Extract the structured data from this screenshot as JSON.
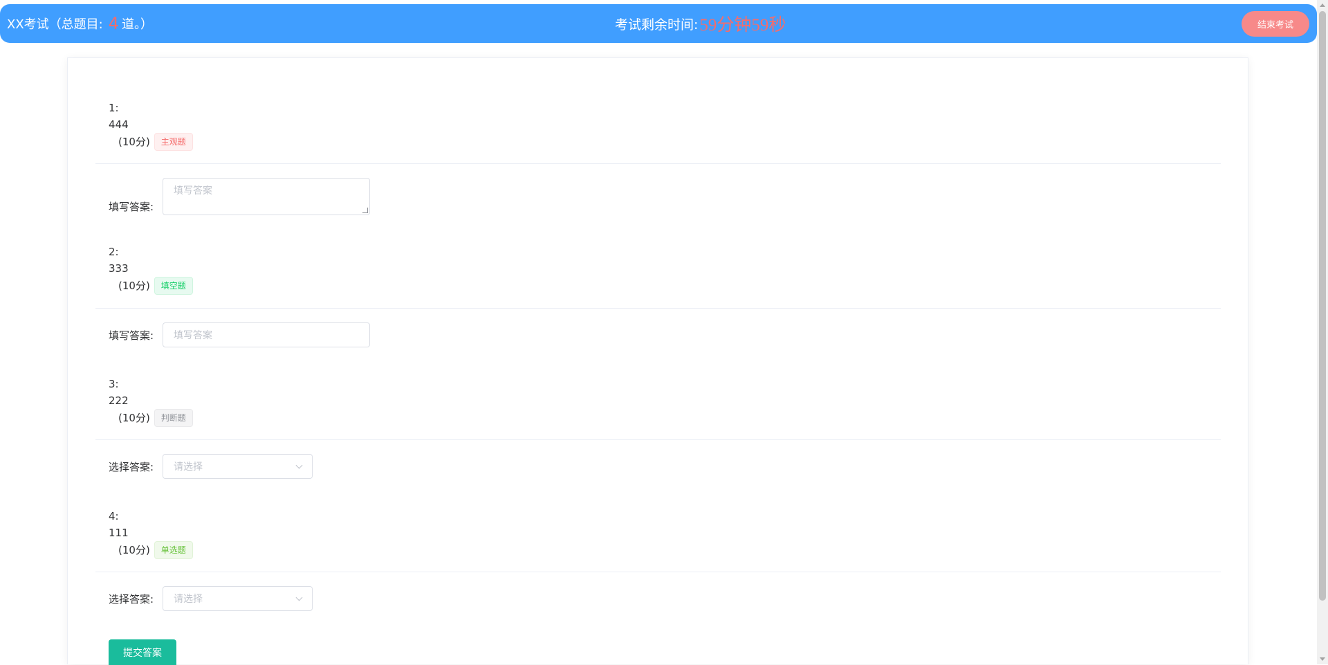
{
  "header": {
    "title_prefix": "XX考试（总题目:",
    "question_count": "4",
    "title_suffix": "道。）",
    "timer_label": "考试剩余时间:",
    "timer_value": "59分钟59秒",
    "end_button": "结束考试"
  },
  "questions": [
    {
      "number": "1:",
      "content": "444",
      "score": "(10分)",
      "tag": "主观题",
      "answer_label": "填写答案:",
      "placeholder": "填写答案"
    },
    {
      "number": "2:",
      "content": "333",
      "score": "(10分)",
      "tag": "填空题",
      "answer_label": "填写答案:",
      "placeholder": "填写答案"
    },
    {
      "number": "3:",
      "content": "222",
      "score": "(10分)",
      "tag": "判断题",
      "answer_label": "选择答案:",
      "placeholder": "请选择"
    },
    {
      "number": "4:",
      "content": "111",
      "score": "(10分)",
      "tag": "单选题",
      "answer_label": "选择答案:",
      "placeholder": "请选择"
    }
  ],
  "submit_button": "提交答案",
  "colors": {
    "header": "#409eff",
    "timer": "#f56c6c",
    "end_button": "#f78989",
    "submit_button": "#1abc9c"
  }
}
